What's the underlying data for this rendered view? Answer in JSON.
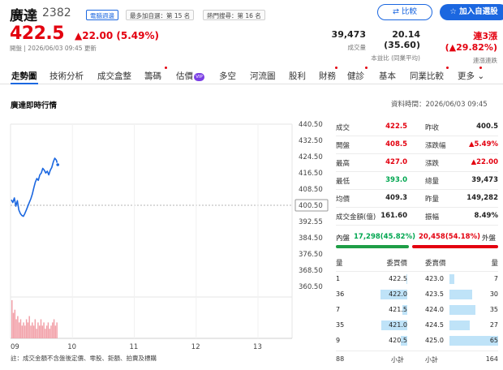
{
  "stock": {
    "name": "廣達",
    "code": "2382",
    "tags": [
      "電腦週邊",
      "最多加自選：第 15 名",
      "熱門搜尋：第 16 名"
    ],
    "price": "422.5",
    "change": "▲22.00 (5.49%)",
    "time_info": "開盤 | 2026/06/03 09:45 更新"
  },
  "buttons": {
    "compare": "比較",
    "watchlist": "加入自選股"
  },
  "header_stats": [
    {
      "value": "39,473",
      "label": "成交量"
    },
    {
      "value": "20.14 (35.60)",
      "label": "本益比 (同業平均)"
    },
    {
      "value": "連3漲 (▲29.82%)",
      "label": "連漲連跌"
    }
  ],
  "tabs": [
    "走勢圖",
    "技術分析",
    "成交盒整",
    "籌碼",
    "估價",
    "多空",
    "河流圖",
    "股利",
    "財務",
    "健診",
    "基本",
    "同業比較",
    "更多"
  ],
  "vip_label": "VIP",
  "section": {
    "title": "廣達即時行情",
    "updated": "資料時間：2026/06/03 09:45"
  },
  "quote_rows": [
    {
      "l1": "成交",
      "v1": "422.5",
      "c1": "red",
      "l2": "昨收",
      "v2": "400.5",
      "c2": "blk"
    },
    {
      "l1": "開盤",
      "v1": "408.5",
      "c1": "red",
      "l2": "漲跌幅",
      "v2": "▲5.49%",
      "c2": "red"
    },
    {
      "l1": "最高",
      "v1": "427.0",
      "c1": "red",
      "l2": "漲跌",
      "v2": "▲22.00",
      "c2": "red"
    },
    {
      "l1": "最低",
      "v1": "393.0",
      "c1": "green",
      "l2": "總量",
      "v2": "39,473",
      "c2": "blk"
    },
    {
      "l1": "均價",
      "v1": "409.3",
      "c1": "blk",
      "l2": "昨量",
      "v2": "149,282",
      "c2": "blk"
    },
    {
      "l1": "成交金額(億)",
      "v1": "161.60",
      "c1": "blk",
      "l2": "振幅",
      "v2": "8.49%",
      "c2": "blk"
    }
  ],
  "inout": {
    "in_label": "內盤",
    "in_value": "17,298(45.82%)",
    "in_pct": 0.4582,
    "out_value": "20,458(54.18%)",
    "out_label": "外盤"
  },
  "orderbook": {
    "headers": [
      "量",
      "委買價",
      "委賣價",
      "量"
    ],
    "rows": [
      {
        "bq": "1",
        "bp": "422.5",
        "ap": "423.0",
        "aq": "7"
      },
      {
        "bq": "36",
        "bp": "422.0",
        "ap": "423.5",
        "aq": "30"
      },
      {
        "bq": "7",
        "bp": "421.5",
        "ap": "424.0",
        "aq": "35"
      },
      {
        "bq": "35",
        "bp": "421.0",
        "ap": "424.5",
        "aq": "27"
      },
      {
        "bq": "9",
        "bp": "420.5",
        "ap": "425.0",
        "aq": "65"
      }
    ],
    "total": {
      "bq": "88",
      "bl": "小計",
      "al": "小計",
      "aq": "164"
    }
  },
  "footnote": "註：成交金額不含盤後定價、零股、鉅額、拍賣及標購",
  "chart_data": {
    "type": "line",
    "x_ticks": [
      "09",
      "10",
      "11",
      "12",
      "13"
    ],
    "y_ticks": [
      "440.50",
      "432.50",
      "424.50",
      "416.50",
      "408.50",
      "400.50",
      "392.55",
      "384.50",
      "376.50",
      "368.50",
      "360.50"
    ],
    "ref_price": 400.5,
    "ylim": [
      356.5,
      444.5
    ],
    "price_series": [
      {
        "t": 0,
        "v": 403.5
      },
      {
        "t": 1,
        "v": 402
      },
      {
        "t": 2,
        "v": 404.5
      },
      {
        "t": 3,
        "v": 400
      },
      {
        "t": 4,
        "v": 403
      },
      {
        "t": 5,
        "v": 398
      },
      {
        "t": 6,
        "v": 396
      },
      {
        "t": 7,
        "v": 395
      },
      {
        "t": 8,
        "v": 394.5
      },
      {
        "t": 9,
        "v": 396
      },
      {
        "t": 10,
        "v": 398
      },
      {
        "t": 11,
        "v": 400
      },
      {
        "t": 12,
        "v": 402
      },
      {
        "t": 13,
        "v": 404
      },
      {
        "t": 14,
        "v": 406.5
      },
      {
        "t": 15,
        "v": 410
      },
      {
        "t": 16,
        "v": 413
      },
      {
        "t": 17,
        "v": 415
      },
      {
        "t": 18,
        "v": 414
      },
      {
        "t": 19,
        "v": 417
      },
      {
        "t": 20,
        "v": 418
      },
      {
        "t": 21,
        "v": 420.5
      },
      {
        "t": 22,
        "v": 419.5
      },
      {
        "t": 23,
        "v": 418
      },
      {
        "t": 24,
        "v": 419
      },
      {
        "t": 25,
        "v": 417
      },
      {
        "t": 26,
        "v": 419.5
      },
      {
        "t": 27,
        "v": 421
      },
      {
        "t": 28,
        "v": 424
      },
      {
        "t": 29,
        "v": 426
      },
      {
        "t": 30,
        "v": 425
      },
      {
        "t": 31,
        "v": 422.5
      }
    ],
    "volume_series": [
      12,
      8,
      9,
      6,
      7,
      5,
      6,
      4,
      5,
      4,
      6,
      5,
      7,
      4,
      5,
      4,
      6,
      3,
      5,
      4,
      6,
      4,
      5,
      3,
      4,
      5,
      3,
      4,
      5,
      6,
      4,
      5
    ],
    "volume_max": 13,
    "session_minutes": 270,
    "elapsed_minutes": 45
  }
}
